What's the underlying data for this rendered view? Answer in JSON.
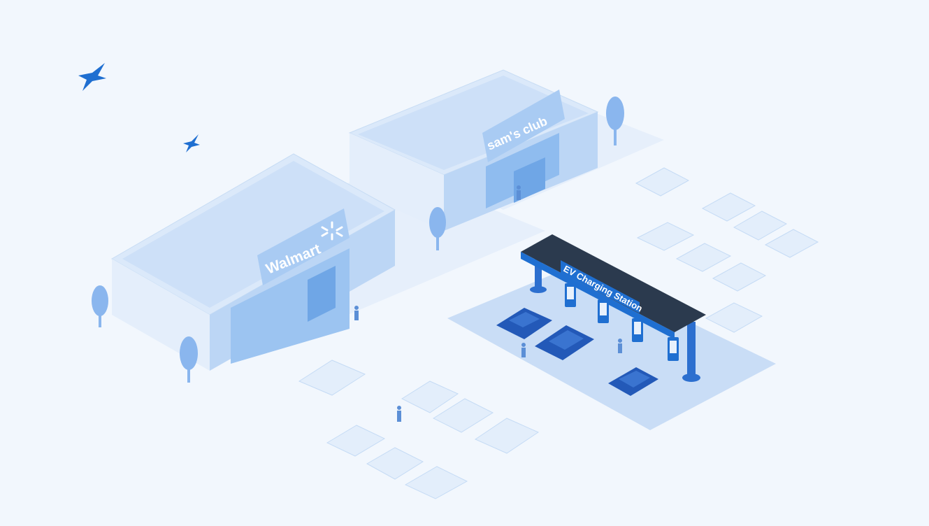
{
  "scene": {
    "walmart_sign": "Walmart",
    "sams_sign": "sam's club",
    "ev_sign": "EV Charging Station"
  },
  "colors": {
    "background": "#f2f7fd",
    "building_light": "#dbe9fa",
    "building_mid": "#bcd6f5",
    "building_dark": "#8fbcef",
    "accent_blue": "#1f6fd1",
    "ev_car": "#2359b8",
    "solar": "#2b3a4e",
    "tree": "#8ab6ee",
    "parked_car": "#e3eefb"
  }
}
